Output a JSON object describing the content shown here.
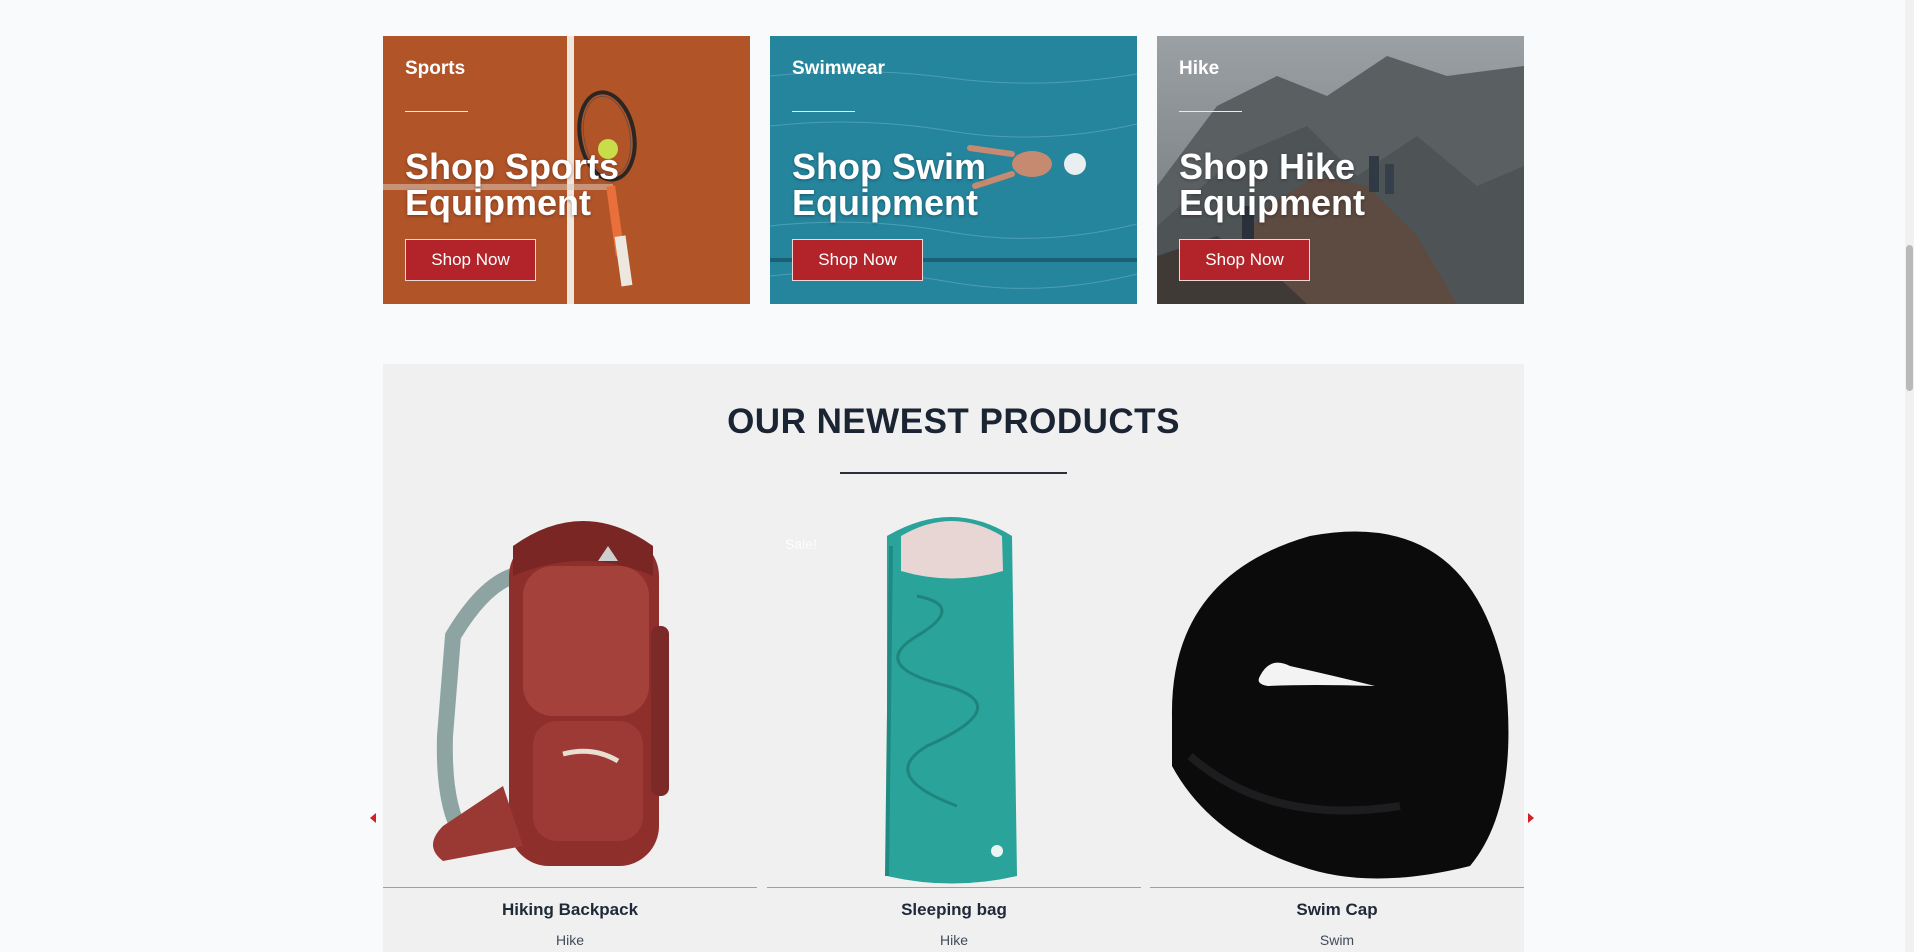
{
  "promos": [
    {
      "category": "Sports",
      "title": "Shop Sports Equipment",
      "button": "Shop Now"
    },
    {
      "category": "Swimwear",
      "title": "Shop Swim Equipment",
      "button": "Shop Now"
    },
    {
      "category": "Hike",
      "title": "Shop Hike Equipment",
      "button": "Shop Now"
    }
  ],
  "products": {
    "title": "OUR NEWEST PRODUCTS",
    "items": [
      {
        "name": "Hiking Backpack",
        "category": "Hike",
        "badge": ""
      },
      {
        "name": "Sleeping bag",
        "category": "Hike",
        "badge": "Sale!"
      },
      {
        "name": "Swim Cap",
        "category": "Swim",
        "badge": ""
      }
    ],
    "prev_icon": "chevron-left-icon",
    "next_icon": "chevron-right-icon"
  },
  "colors": {
    "accent": "#b3242a",
    "heading": "#1b2433",
    "section_bg": "#f0f0f0"
  }
}
